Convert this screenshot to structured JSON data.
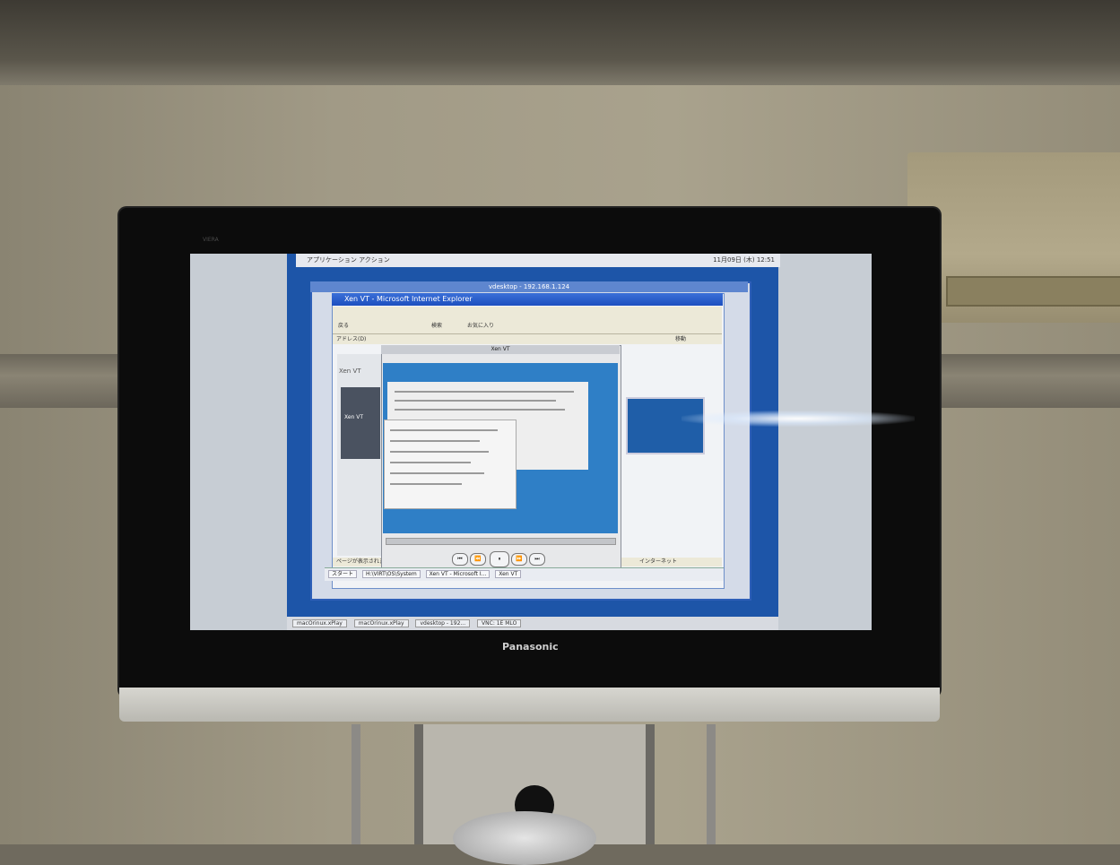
{
  "tv": {
    "brand": "Panasonic",
    "brand_small": "VIERA"
  },
  "desktop": {
    "top_menu": "アプリケーション アクション",
    "clock": "11月09日 (木) 12:51",
    "bottom_items": [
      "macOrinux.xPlay",
      "macOrinux.xPlay",
      "vdesktop - 192...",
      "VNC: 1E MLO"
    ]
  },
  "vnc_window": {
    "title": "vdesktop - 192.168.1.124"
  },
  "ie_window": {
    "title": "Xen VT - Microsoft Internet Explorer",
    "address_label": "アドレス(D)",
    "go_label": "移動",
    "toolbar_back": "戻る",
    "toolbar_search": "検索",
    "toolbar_fav": "お気に入り",
    "status_left": "ページが表示されました",
    "status_right": "インターネット",
    "left_heading": "Xen VT",
    "left_panel_label": "Xen VT"
  },
  "player_window": {
    "title": "Xen VT",
    "controls": [
      "⏮",
      "⏪",
      "⏸",
      "⏩",
      "⏭"
    ]
  },
  "xp_taskbar": {
    "start": "スタート",
    "items": [
      "H:\\VIRT\\OS\\System",
      "Xen VT - Microsoft I...",
      "Xen VT"
    ]
  }
}
